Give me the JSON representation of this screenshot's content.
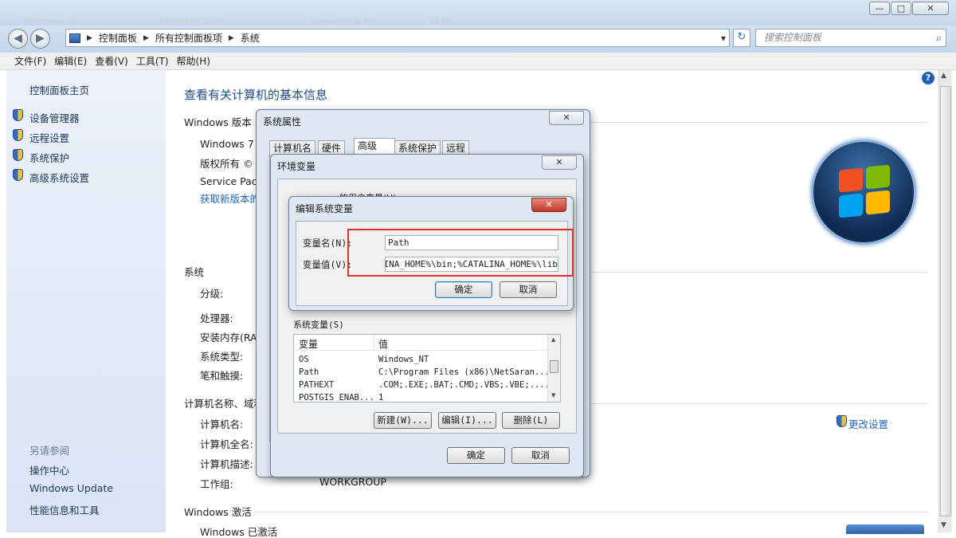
{
  "window": {
    "min_glyph": "—",
    "max_glyph": "□",
    "close_glyph": "✕",
    "ghost_row": [
      "fonshttmpp.jar",
      "2020/01/30 13:20",
      "Executable Jar File",
      "64 KB"
    ]
  },
  "address": {
    "crumbs": [
      "控制面板",
      "所有控制面板项",
      "系统"
    ],
    "search_placeholder": "搜索控制面板",
    "dropdown_glyph": "▾",
    "refresh_glyph": "↻",
    "search_glyph": "⌕"
  },
  "menu": [
    "文件(F)",
    "编辑(E)",
    "查看(V)",
    "工具(T)",
    "帮助(H)"
  ],
  "left_pane": {
    "home": "控制面板主页",
    "items": [
      "设备管理器",
      "远程设置",
      "系统保护",
      "高级系统设置"
    ],
    "see_also_header": "另请参阅",
    "see_also": [
      "操作中心",
      "Windows Update",
      "性能信息和工具"
    ]
  },
  "main": {
    "title": "查看有关计算机的基本信息",
    "edition_header": "Windows 版本",
    "edition_lines": [
      "Windows 7 旗",
      "版权所有 © 2",
      "Service Pack",
      "获取新版本的"
    ],
    "system_header": "系统",
    "system_labels": [
      "分级:",
      "处理器:",
      "安装内存(RAM",
      "系统类型:",
      "笔和触摸:"
    ],
    "computer_header": "计算机名称、域和",
    "computer_labels": [
      "计算机名:",
      "计算机全名:",
      "计算机描述:",
      "工作组:"
    ],
    "workgroup_value": "WORKGROUP",
    "change_settings": "更改设置",
    "activation_header": "Windows 激活",
    "activation_line": "Windows 已激活"
  },
  "sysprops": {
    "title": "系统属性",
    "tabs": [
      "计算机名",
      "硬件",
      "高级",
      "系统保护",
      "远程"
    ],
    "selected_tab": "高级",
    "confirm": "确定",
    "cancel": "取消"
  },
  "envvars": {
    "title": "环境变量",
    "user_vars_header": "的用户变量(U)",
    "sys_vars_header": "系统变量(S)",
    "col_var": "变量",
    "col_val": "值",
    "rows": [
      {
        "name": "OS",
        "value": "Windows_NT"
      },
      {
        "name": "Path",
        "value": "C:\\Program Files (x86)\\NetSaran..."
      },
      {
        "name": "PATHEXT",
        "value": ".COM;.EXE;.BAT;.CMD;.VBS;.VBE;...."
      },
      {
        "name": "POSTGIS_ENAB...",
        "value": "1"
      }
    ],
    "btn_new": "新建(W)...",
    "btn_edit": "编辑(I)...",
    "btn_delete": "删除(L)",
    "confirm": "确定",
    "cancel": "取消"
  },
  "editvar": {
    "title": "编辑系统变量",
    "name_label": "变量名(N):",
    "value_label": "变量值(V):",
    "name_value": "Path",
    "value_value": "ALINA_HOME%\\bin;%CATALINA_HOME%\\lib",
    "confirm": "确定",
    "cancel": "取消"
  }
}
